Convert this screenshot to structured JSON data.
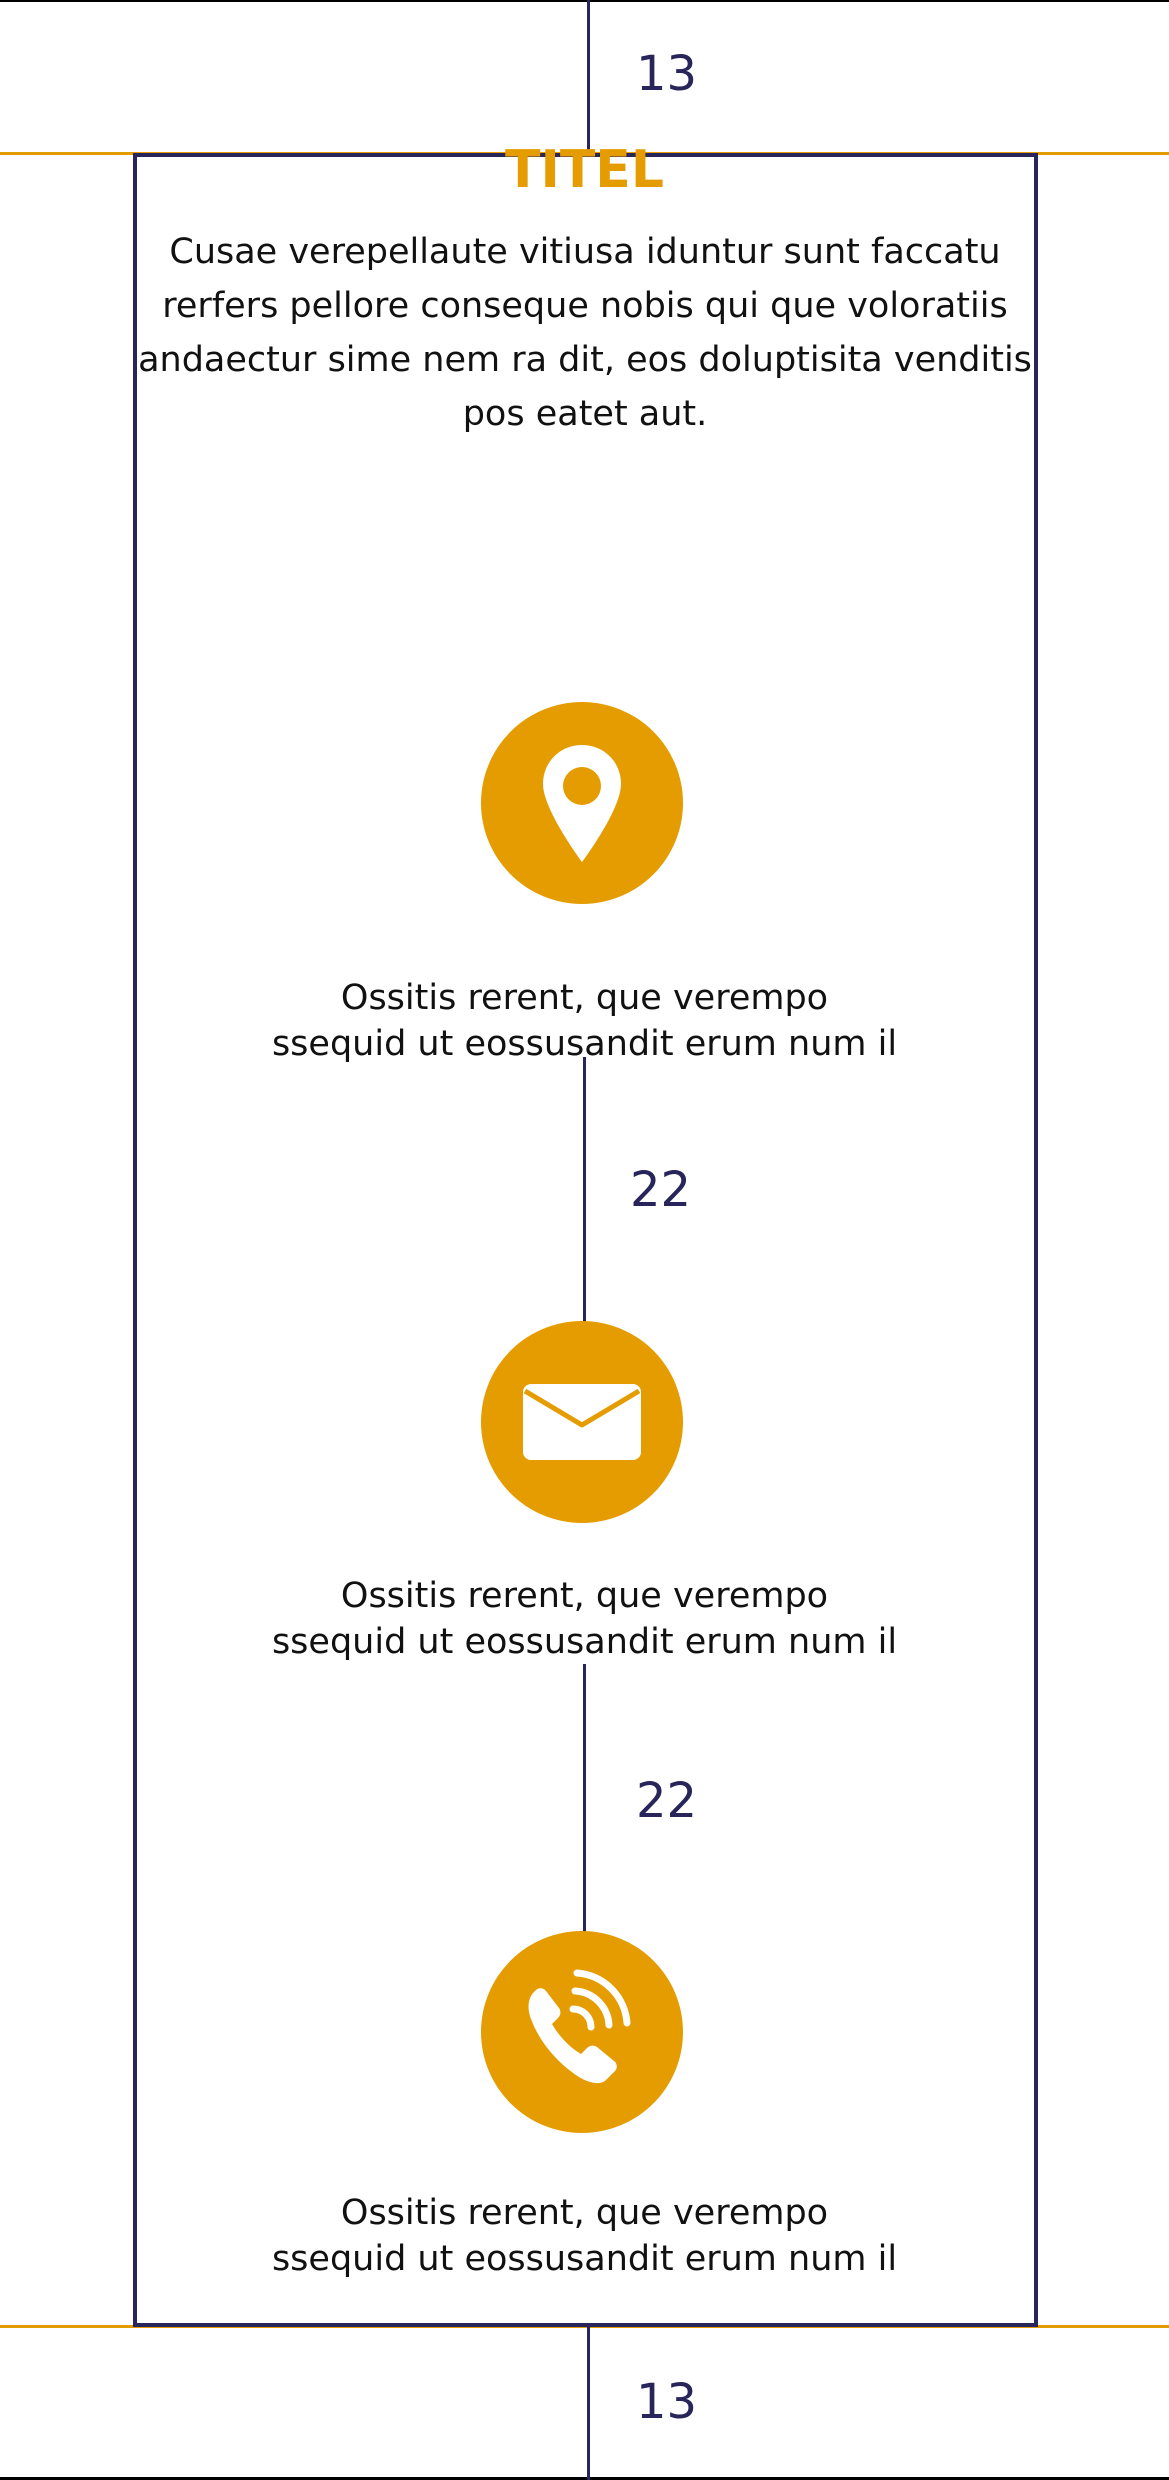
{
  "colors": {
    "accent": "#e59c00",
    "rule": "#27255a",
    "text": "#111111"
  },
  "page": {
    "title": "TITEL",
    "intro": "Cusae verepellaute vitiusa iduntur sunt faccatu rerfers pellore conseque nobis qui que voloratiis andaectur sime nem ra dit, eos doluptisita venditis pos eatet aut."
  },
  "dimensions": {
    "top_spacing": "13",
    "gap_1": "22",
    "gap_2": "22",
    "bottom_spacing": "13"
  },
  "items": [
    {
      "icon": "location-pin-icon",
      "line1": "Ossitis rerent, que verempo",
      "line2": "ssequid ut eossusandit erum num il"
    },
    {
      "icon": "envelope-icon",
      "line1": "Ossitis rerent, que verempo",
      "line2": "ssequid ut eossusandit erum num il"
    },
    {
      "icon": "phone-icon",
      "line1": "Ossitis rerent, que verempo",
      "line2": "ssequid ut eossusandit erum num il"
    }
  ]
}
